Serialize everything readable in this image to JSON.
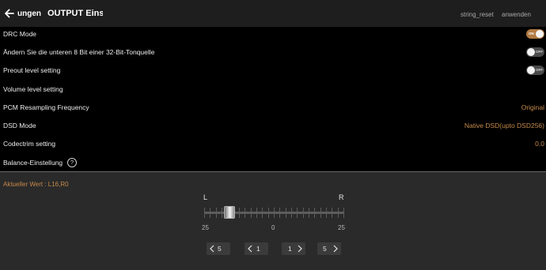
{
  "header": {
    "back_label": "ungen",
    "title": "OUTPUT Einste",
    "reset_label": "string_reset",
    "apply_label": "anwenden"
  },
  "settings": [
    {
      "label": "DRC Mode",
      "toggle": true,
      "toggle_state": "ON"
    },
    {
      "label": "Ändern Sie die unteren 8 Bit einer 32-Bit-Tonquelle",
      "toggle": true,
      "toggle_state": "OFF"
    },
    {
      "label": "Preout level setting",
      "toggle": true,
      "toggle_state": "OFF"
    },
    {
      "label": "Volume level setting"
    },
    {
      "label": "PCM Resampling Frequency",
      "value": "Original"
    },
    {
      "label": "DSD Mode",
      "value": "Native DSD(upto DSD256)"
    },
    {
      "label": "Codectrim setting",
      "value": "0.0"
    },
    {
      "label": "Balance-Einstellung",
      "help_icon": "question-circle-icon",
      "help_glyph": "?"
    }
  ],
  "balance": {
    "current_label": "Aktueller Wert : L16,R0",
    "left_label": "L",
    "right_label": "R",
    "scale_left": "25",
    "scale_mid": "0",
    "scale_right": "25",
    "range": [
      -25,
      25
    ],
    "value": -16,
    "buttons": {
      "left5": "5",
      "left1": "1",
      "right1": "1",
      "right5": "5"
    }
  },
  "colors": {
    "accent": "#c68a4a",
    "toggle_on": "#b27a42",
    "toggle_off": "#4a4a4a",
    "background": "#000000",
    "header_bg": "#1e1e1e",
    "panel_bg": "#2a2a2a"
  },
  "icons": {
    "back": "arrow-left-icon",
    "help": "question-circle-icon",
    "step_left": "chevron-left-icon",
    "step_right": "chevron-right-icon"
  }
}
